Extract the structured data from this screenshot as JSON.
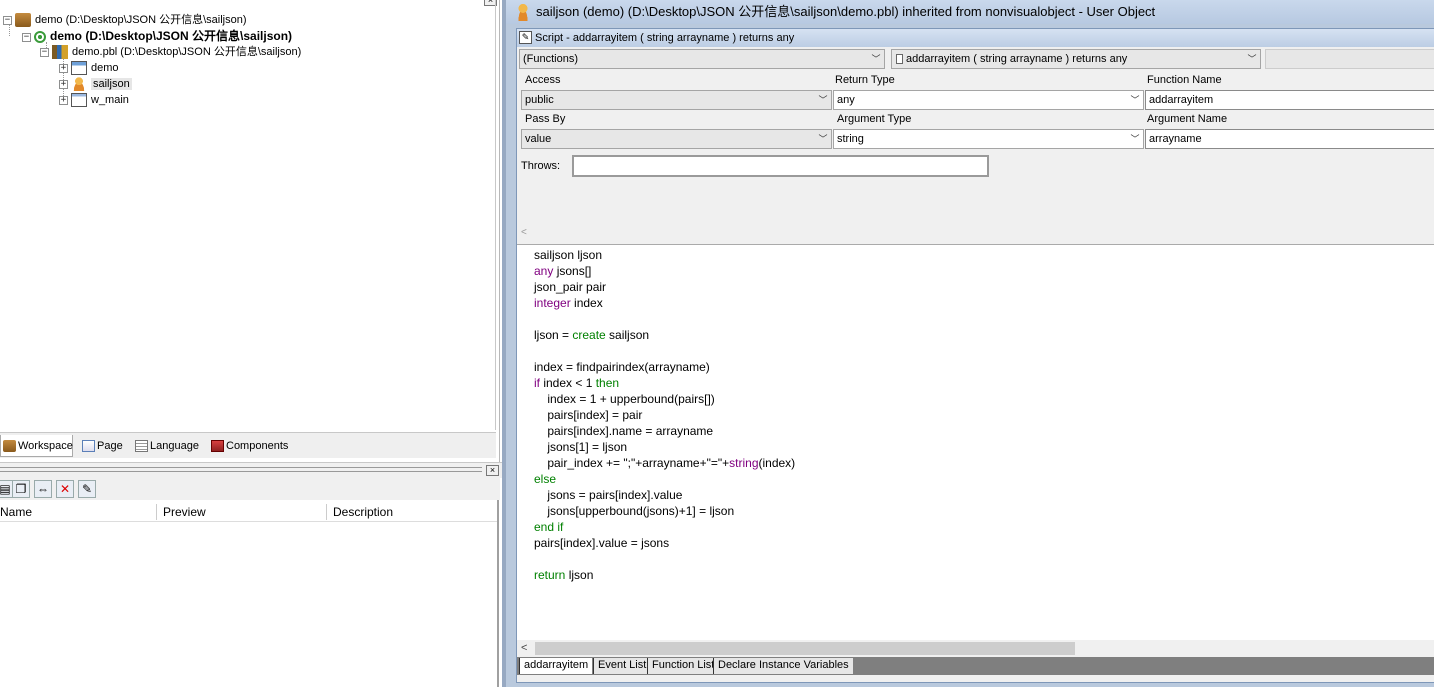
{
  "workspace": {
    "tree": [
      {
        "label": "demo (D:\\Desktop\\JSON 公开信息\\sailjson)"
      },
      {
        "label": "demo (D:\\Desktop\\JSON 公开信息\\sailjson)"
      },
      {
        "label": "demo.pbl (D:\\Desktop\\JSON 公开信息\\sailjson)"
      },
      {
        "label": "demo"
      },
      {
        "label": "sailjson"
      },
      {
        "label": "w_main"
      }
    ],
    "tabs": [
      "Workspace",
      "Page",
      "Language",
      "Components"
    ]
  },
  "list_panel": {
    "columns": [
      "Name",
      "Preview",
      "Description"
    ]
  },
  "window": {
    "title": "sailjson (demo) (D:\\Desktop\\JSON 公开信息\\sailjson\\demo.pbl) inherited from nonvisualobject - User Object"
  },
  "script": {
    "header": "Script - addarrayitem ( string arrayname )  returns any",
    "object_dropdown": "(Functions)",
    "function_dropdown": "addarrayitem ( string arrayname )  returns any",
    "labels": {
      "access": "Access",
      "return_type": "Return Type",
      "function_name": "Function Name",
      "pass_by": "Pass By",
      "argument_type": "Argument Type",
      "argument_name": "Argument Name",
      "throws": "Throws:"
    },
    "values": {
      "access": "public",
      "return_type": "any",
      "function_name": "addarrayitem",
      "pass_by": "value",
      "argument_type": "string",
      "argument_name": "arrayname",
      "throws": ""
    },
    "code": [
      "sailjson ljson",
      "any jsons[]",
      "json_pair pair",
      "integer index",
      "",
      "ljson = create sailjson",
      "",
      "index = findpairindex(arrayname)",
      "if index < 1 then",
      "    index = 1 + upperbound(pairs[])",
      "    pairs[index] = pair",
      "    pairs[index].name = arrayname",
      "    jsons[1] = ljson",
      "    pair_index += \";\"+arrayname+\"=\"+string(index)",
      "else",
      "    jsons = pairs[index].value",
      "    jsons[upperbound(jsons)+1] = ljson",
      "end if",
      "pairs[index].value = jsons",
      "",
      "return ljson"
    ],
    "tabs": [
      "addarrayitem",
      "Event List",
      "Function List",
      "Declare Instance Variables"
    ]
  },
  "colors": {
    "keyword_purple": "#800080",
    "keyword_green": "#008000",
    "window_frame": "#b9c9dd"
  }
}
